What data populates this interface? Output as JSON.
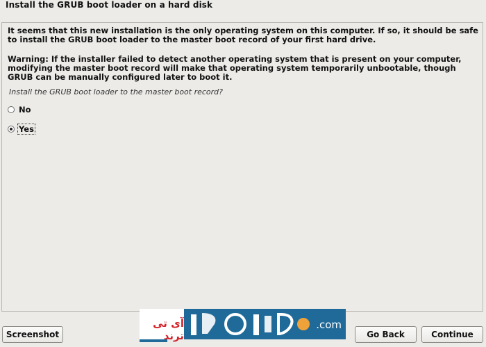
{
  "header": {
    "title": "Install the GRUB boot loader on a hard disk"
  },
  "content": {
    "paragraph1": "It seems that this new installation is the only operating system on this computer. If so, it should be safe to install the GRUB boot loader to the master boot record of your first hard drive.",
    "paragraph2": "Warning: If the installer failed to detect another operating system that is present on your computer, modifying the master boot record will make that operating system temporarily unbootable, though GRUB can be manually configured later to boot it.",
    "question": "Install the GRUB boot loader to the master boot record?",
    "options": [
      {
        "label": "No",
        "selected": false
      },
      {
        "label": "Yes",
        "selected": true
      }
    ]
  },
  "buttons": {
    "screenshot": "Screenshot",
    "go_back": "Go Back",
    "continue": "Continue"
  },
  "watermark": {
    "text_fa": "آی تی ترند",
    "domain": ".com"
  }
}
